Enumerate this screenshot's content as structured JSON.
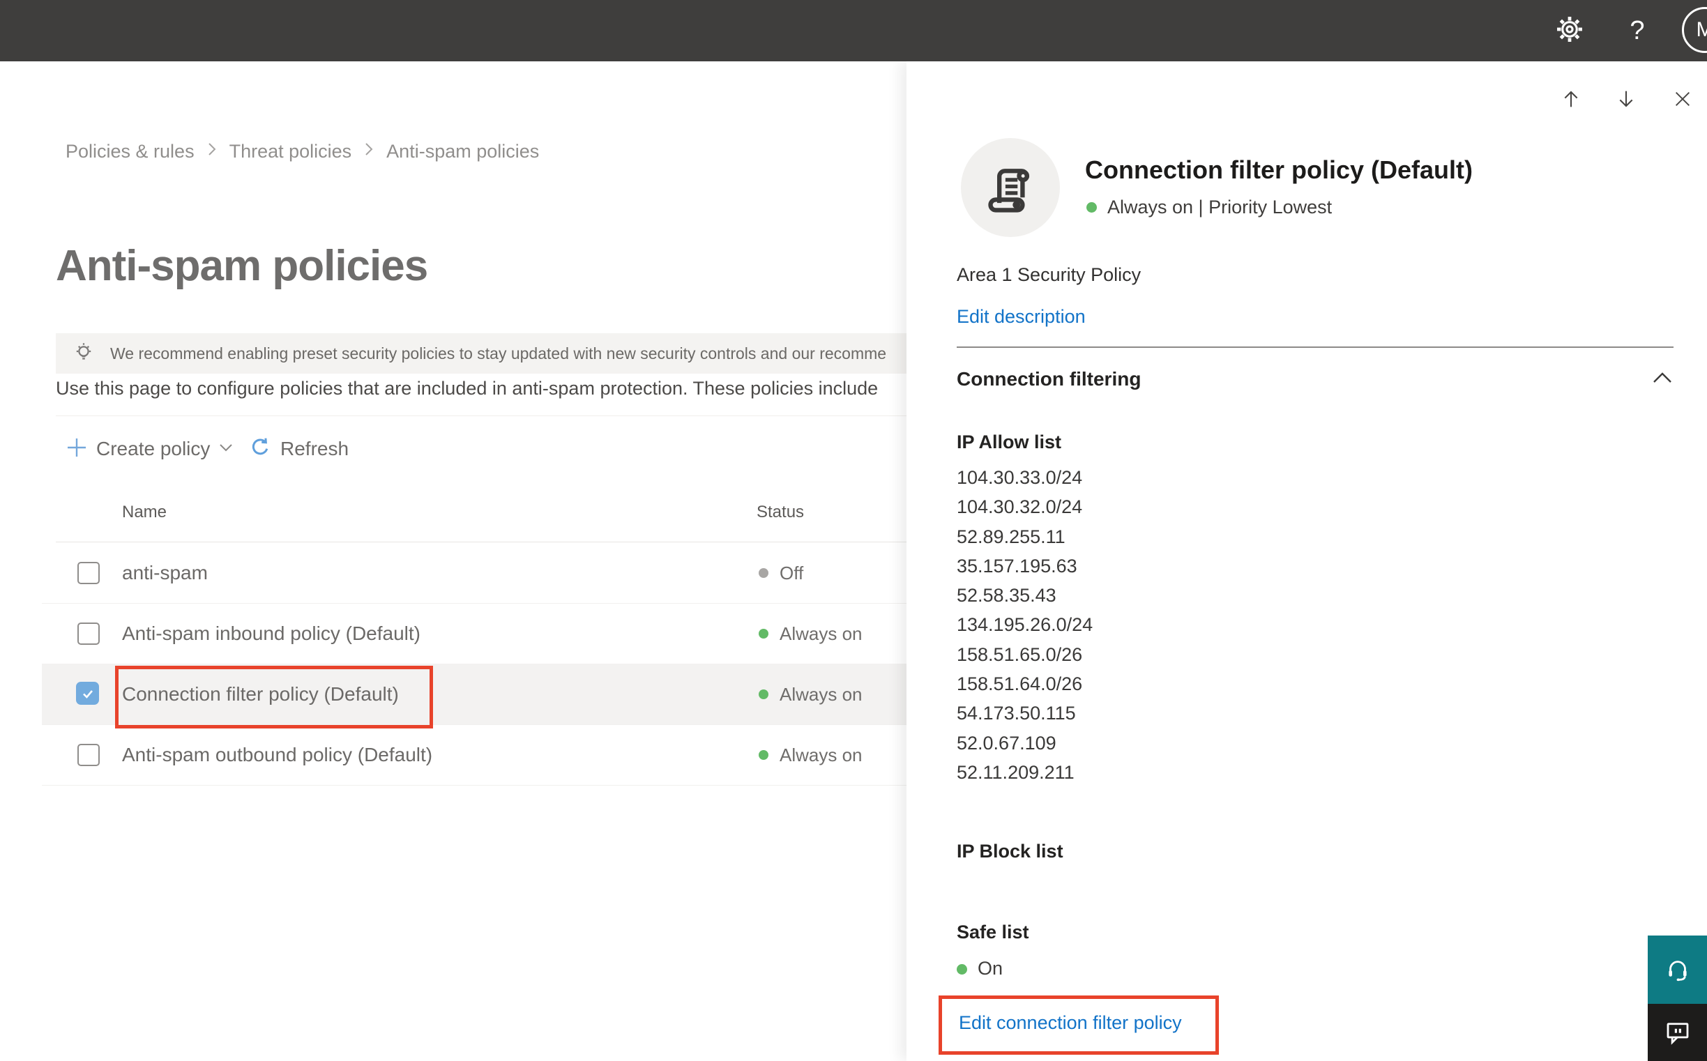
{
  "topbar": {
    "help_label": "?",
    "avatar_initial": "M"
  },
  "breadcrumb": {
    "items": [
      "Policies & rules",
      "Threat policies",
      "Anti-spam policies"
    ]
  },
  "main": {
    "title": "Anti-spam policies",
    "banner_text": "We recommend enabling preset security policies to stay updated with new security controls and our recomme",
    "description": "Use this page to configure policies that are included in anti-spam protection. These policies include",
    "toolbar": {
      "create_policy": "Create policy",
      "refresh": "Refresh"
    },
    "table": {
      "columns": {
        "name": "Name",
        "status": "Status"
      },
      "rows": [
        {
          "name": "anti-spam",
          "status": "Off"
        },
        {
          "name": "Anti-spam inbound policy (Default)",
          "status": "Always on"
        },
        {
          "name": "Connection filter policy (Default)",
          "status": "Always on"
        },
        {
          "name": "Anti-spam outbound policy (Default)",
          "status": "Always on"
        }
      ]
    }
  },
  "flyout": {
    "title": "Connection filter policy (Default)",
    "status_line": "Always on | Priority Lowest",
    "policy_description": "Area 1 Security Policy",
    "edit_description_link": "Edit description",
    "section_title": "Connection filtering",
    "ip_allow_title": "IP Allow list",
    "ip_allow": [
      "104.30.33.0/24",
      "104.30.32.0/24",
      "52.89.255.11",
      "35.157.195.63",
      "52.58.35.43",
      "134.195.26.0/24",
      "158.51.65.0/26",
      "158.51.64.0/26",
      "54.173.50.115",
      "52.0.67.109",
      "52.11.209.211"
    ],
    "ip_block_title": "IP Block list",
    "safe_list_title": "Safe list",
    "safe_list_status": "On",
    "edit_policy_link": "Edit connection filter policy"
  },
  "colors": {
    "annotation_red": "#e8432b",
    "checkbox_blue": "#72abde",
    "status_green": "#62ba66",
    "status_gray": "#a8a6a4",
    "link_blue": "#1273c8",
    "teal_button": "#0e7b84"
  }
}
